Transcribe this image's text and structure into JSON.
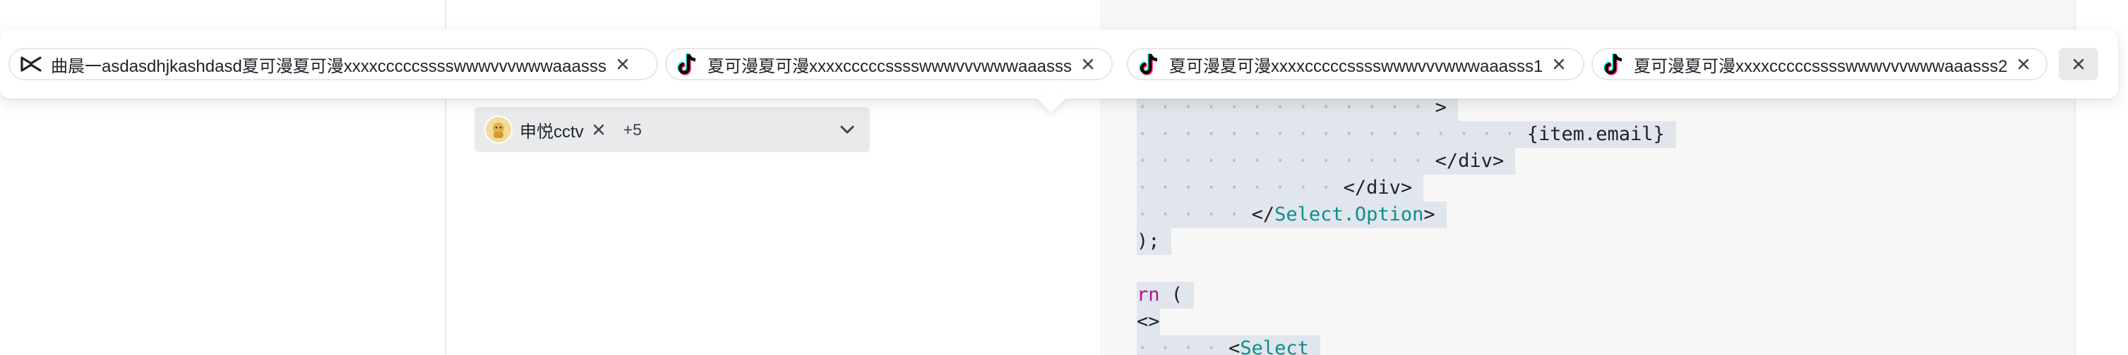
{
  "tabs": [
    {
      "icon": "capcut-icon",
      "label": "曲晨一asdasdhjkashdasd夏可漫夏可漫xxxxcccccsssswwwvvvwwwaaasss"
    },
    {
      "icon": "tiktok-icon",
      "label": "夏可漫夏可漫xxxxcccccsssswwwvvvwwwaaasss"
    },
    {
      "icon": "tiktok-icon",
      "label": "夏可漫夏可漫xxxxcccccsssswwwvvvwwwaaasss1"
    },
    {
      "icon": "tiktok-icon",
      "label": "夏可漫夏可漫xxxxcccccsssswwwvvvwwwaaasss2"
    }
  ],
  "select": {
    "tag_label": "申悦cctv",
    "more_count": "+5"
  },
  "code": {
    "line1_text": ">",
    "line2_text": "{item.email}",
    "line3_text": "</div>",
    "line4_text": "</div>",
    "line5_open": "</",
    "line5_tag": "Select.Option",
    "line5_close": ">",
    "line6_text": ");",
    "line8_kw": "rn",
    "line8_rest": " (",
    "line9_text": "<>",
    "line10_open": "<",
    "line10_tag": "Select"
  }
}
